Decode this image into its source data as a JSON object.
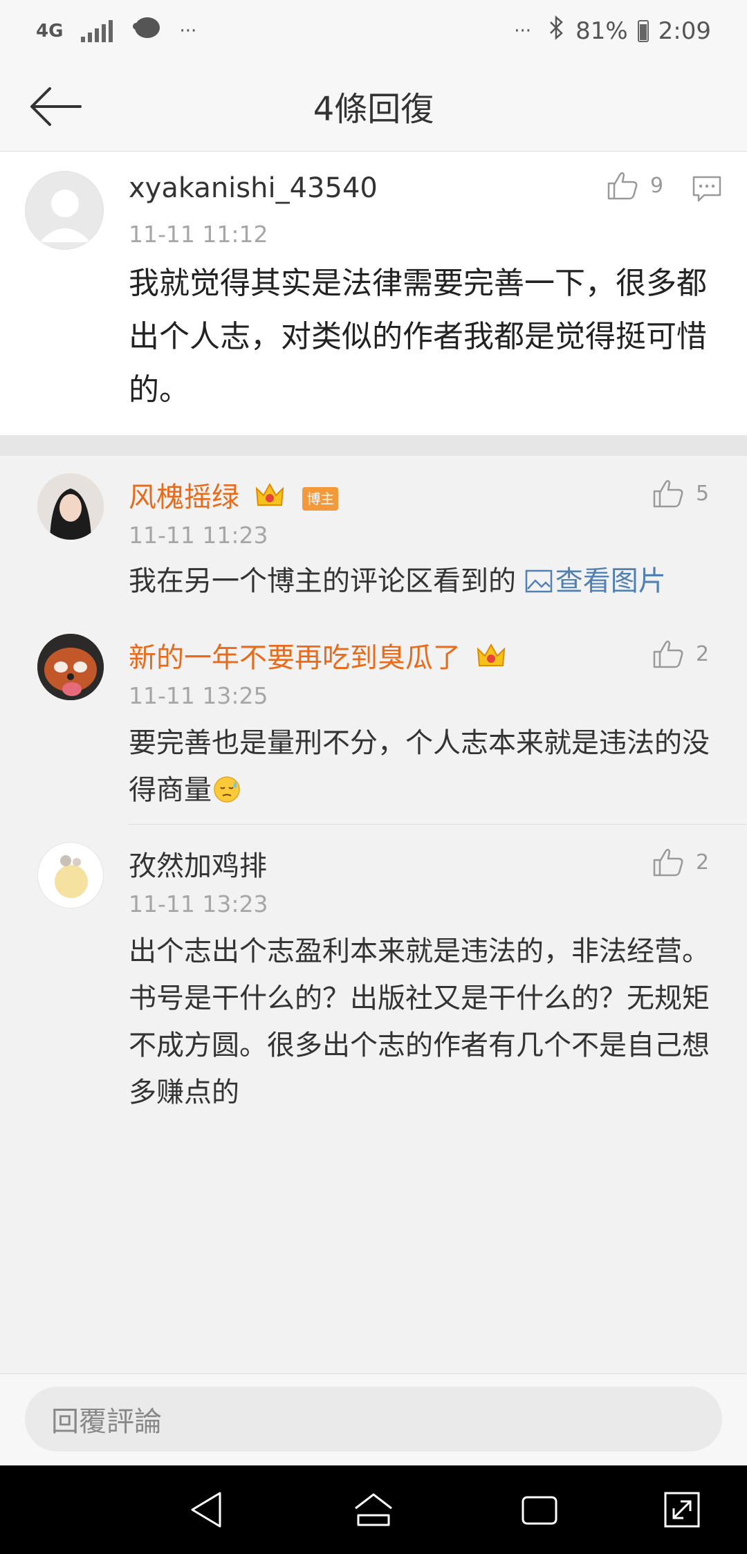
{
  "status_bar": {
    "network": "4G",
    "dots_left": "···",
    "dots_right": "···",
    "battery": "81%",
    "time": "2:09"
  },
  "header": {
    "title": "4條回復",
    "back_icon": "back-arrow-icon"
  },
  "main_comment": {
    "username": "xyakanishi_43540",
    "time": "11-11 11:12",
    "likes": "9",
    "content": "我就觉得其实是法律需要完善一下，很多都出个人志，对类似的作者我都是觉得挺可惜的。"
  },
  "replies": [
    {
      "username": "风槐摇绿",
      "badge": "博主",
      "time": "11-11 11:23",
      "likes": "5",
      "content": "我在另一个博主的评论区看到的 ",
      "link": "查看图片"
    },
    {
      "username": "新的一年不要再吃到臭瓜了",
      "time": "11-11 13:25",
      "likes": "2",
      "content": "要完善也是量刑不分，个人志本来就是违法的没得商量"
    },
    {
      "username": "孜然加鸡排",
      "time": "11-11 13:23",
      "likes": "2",
      "content": "出个志出个志盈利本来就是违法的，非法经营。书号是干什么的？出版社又是干什么的？无规矩不成方圆。很多出个志的作者有几个不是自己想多赚点的"
    }
  ],
  "input": {
    "placeholder": "回覆評論"
  },
  "colors": {
    "accent_orange": "#e86b1c",
    "link_blue": "#5180b3",
    "badge_orange": "#f3993b"
  }
}
